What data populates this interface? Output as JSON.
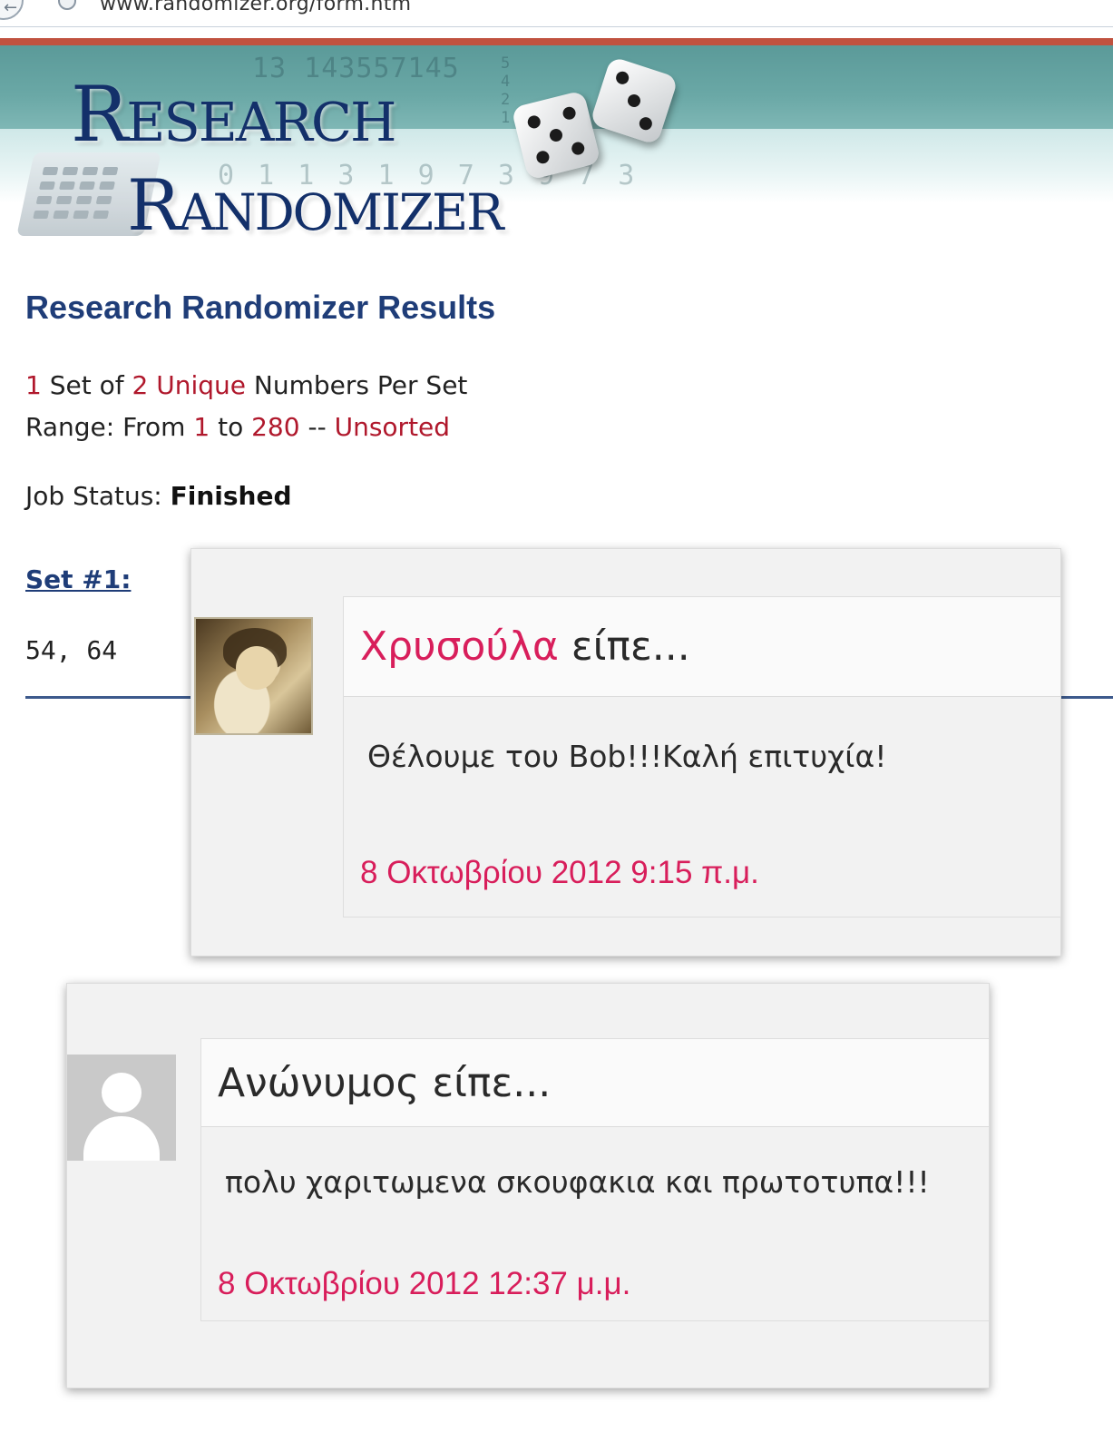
{
  "browser": {
    "url_visible": "www.randomizer.org/form.htm"
  },
  "header": {
    "logo_line_1": "Research",
    "logo_line_2": "Randomizer",
    "digits_top": "13 143557145",
    "digits_mid": "0 1 1 3 1 9 7 3 9 7 3",
    "digits_vertical": "5 4 2 1"
  },
  "results": {
    "title": "Research Randomizer Results",
    "sets_count": "1",
    "set_of": "Set of",
    "numbers_count": "2",
    "unique": "Unique",
    "numbers_per_set": "Numbers Per Set",
    "range_prefix": "Range: From",
    "range_from": "1",
    "range_to_word": "to",
    "range_to": "280",
    "range_sep": "--",
    "sorting": "Unsorted",
    "job_status_label": "Job Status:",
    "job_status_value": "Finished",
    "set_link": "Set #1:",
    "set_values": "54, 64"
  },
  "comments": [
    {
      "author": "Χρυσούλα",
      "said": "είπε...",
      "text": "Θέλουμε του Bob!!!Καλή επιτυχία!",
      "date": "8 Οκτωβρίου 2012 9:15 π.μ.",
      "avatar": "user-photo"
    },
    {
      "author": "Ανώνυμος",
      "said": "είπε...",
      "text": "πολυ χαριτωμενα σκουφακια και πρωτοτυπα!!!",
      "date": "8 Οκτωβρίου 2012 12:37 μ.μ.",
      "avatar": "default-user-icon"
    }
  ],
  "colors": {
    "accent_red": "#b0182c",
    "title_blue": "#1f3d78",
    "comment_pink": "#d81e5b",
    "header_teal": "#5b9a99"
  }
}
